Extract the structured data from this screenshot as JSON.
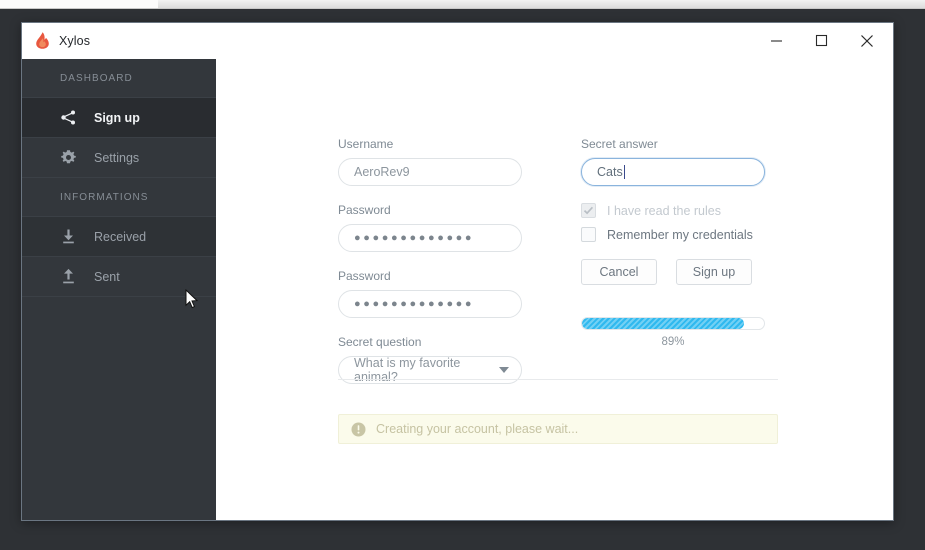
{
  "window": {
    "title": "Xylos",
    "logo_icon": "flame-icon",
    "controls": {
      "minimize": "minimize-icon",
      "maximize": "maximize-icon",
      "close": "close-icon"
    }
  },
  "sidebar": {
    "sections": [
      {
        "header": "DASHBOARD",
        "items": [
          {
            "label": "Sign up",
            "icon": "share-icon",
            "state": "active"
          },
          {
            "label": "Settings",
            "icon": "gear-icon",
            "state": "normal"
          }
        ]
      },
      {
        "header": "INFORMATIONS",
        "items": [
          {
            "label": "Received",
            "icon": "download-icon",
            "state": "hovered"
          },
          {
            "label": "Sent",
            "icon": "upload-icon",
            "state": "normal"
          }
        ]
      }
    ]
  },
  "form": {
    "username": {
      "label": "Username",
      "value": "AeroRev9"
    },
    "password": {
      "label": "Password",
      "value": "●●●●●●●●●●●●●"
    },
    "password_confirm": {
      "label": "Password",
      "value": "●●●●●●●●●●●●●"
    },
    "secret_question": {
      "label": "Secret question",
      "value": "What is my favorite animal?",
      "caret_icon": "chevron-down-icon"
    },
    "secret_answer": {
      "label": "Secret answer",
      "value": "Cats",
      "focused": true
    },
    "checkboxes": [
      {
        "label": "I have read the rules",
        "checked": true,
        "disabled": true
      },
      {
        "label": "Remember my credentials",
        "checked": false,
        "disabled": false
      }
    ],
    "buttons": {
      "cancel": "Cancel",
      "submit": "Sign up"
    },
    "progress": {
      "percent": 89,
      "percent_label": "89%",
      "color": "#2fb9ef"
    }
  },
  "alert": {
    "icon": "exclamation-circle-icon",
    "message": "Creating your account, please wait...",
    "background": "#fbfbeb",
    "text_color": "#c6c3a3"
  }
}
